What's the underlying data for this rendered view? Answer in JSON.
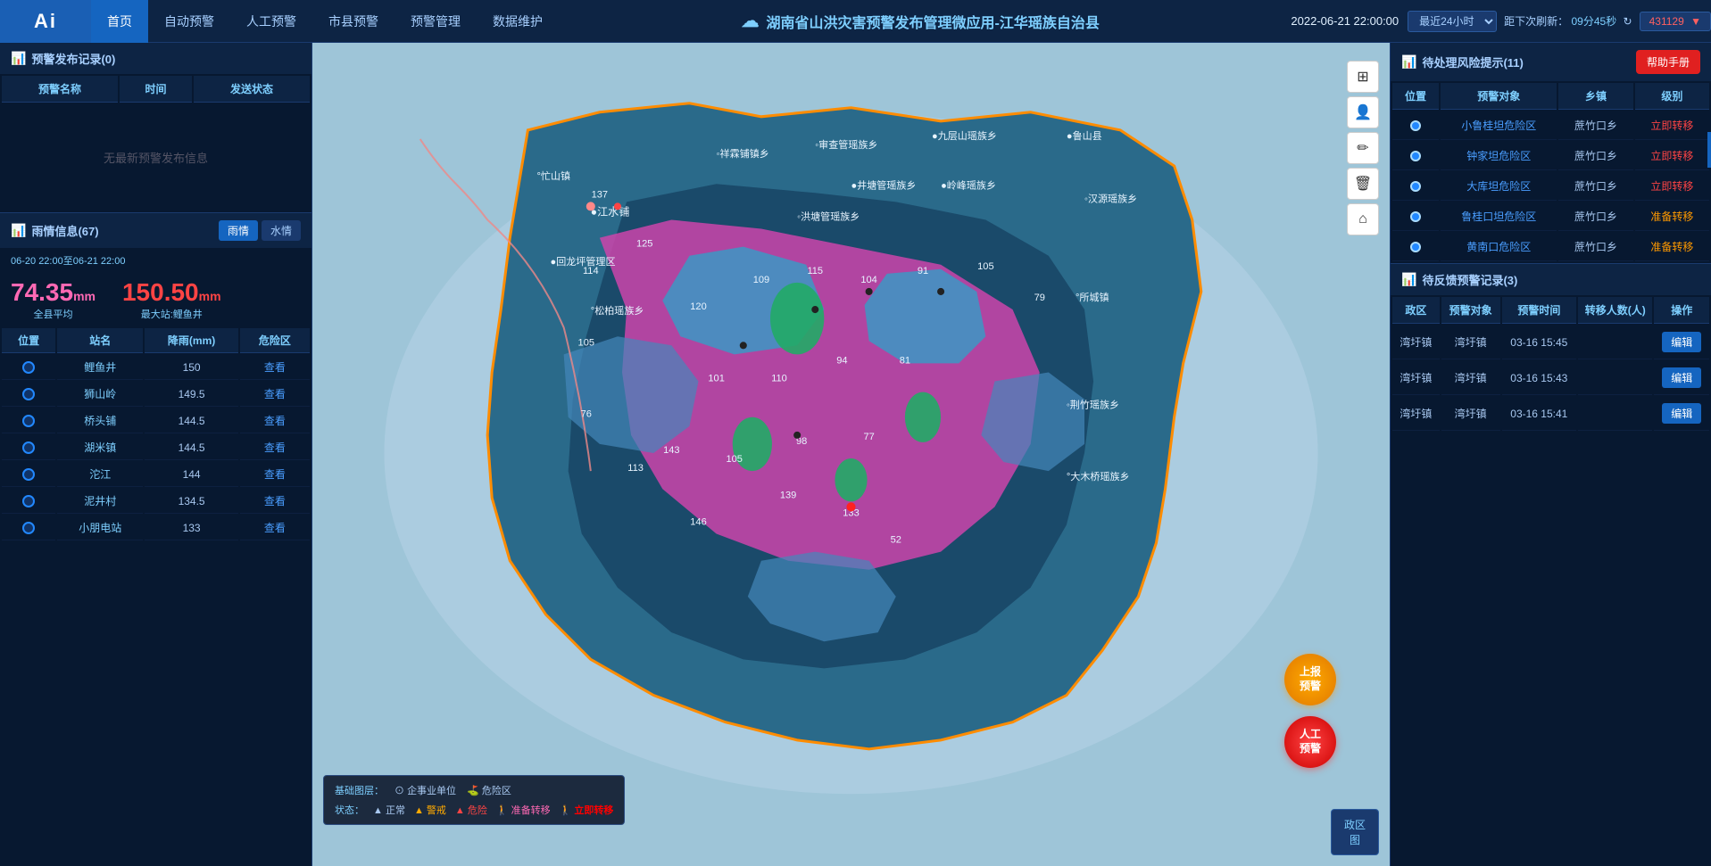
{
  "nav": {
    "logo": "Ai",
    "items": [
      "首页",
      "自动预警",
      "人工预警",
      "市县预警",
      "预警管理",
      "数据维护"
    ],
    "title": "湖南省山洪灾害预警发布管理微应用-江华瑶族自治县",
    "datetime": "2022-06-21 22:00:00",
    "time_range": "最近24小时",
    "refresh_label": "距下次刷新：",
    "refresh_time": "09分45秒",
    "count": "431129"
  },
  "warn_records": {
    "title": "预警发布记录(0)",
    "columns": [
      "预警名称",
      "时间",
      "发送状态"
    ],
    "empty_msg": "无最新预警发布信息"
  },
  "rain_info": {
    "title": "雨情信息(67)",
    "tabs": [
      "雨情",
      "水情"
    ],
    "date_range": "06-20 22:00至06-21 22:00",
    "avg_value": "74.35",
    "avg_unit": "mm",
    "avg_label": "全县平均",
    "max_value": "150.50",
    "max_unit": "mm",
    "max_label": "最大站:鲤鱼井",
    "columns": [
      "位置",
      "站名",
      "降雨(mm)",
      "危险区"
    ],
    "rows": [
      {
        "name": "鲤鱼井",
        "value": "150",
        "link": "查看"
      },
      {
        "name": "狮山岭",
        "value": "149.5",
        "link": "查看"
      },
      {
        "name": "桥头铺",
        "value": "144.5",
        "link": "查看"
      },
      {
        "name": "湖米镇",
        "value": "144.5",
        "link": "查看"
      },
      {
        "name": "沱江",
        "value": "144",
        "link": "查看"
      },
      {
        "name": "泥井村",
        "value": "134.5",
        "link": "查看"
      },
      {
        "name": "小朋电站",
        "value": "133",
        "link": "查看"
      }
    ]
  },
  "map": {
    "base_layer_label": "基础图层：",
    "enterprise_label": "企事业单位",
    "danger_zone_label": "危险区",
    "status_label": "状态：",
    "status_items": [
      "正常",
      "警戒",
      "危险",
      "准备转移",
      "立即转移"
    ],
    "float_btn_upload": [
      "上报",
      "预警"
    ],
    "float_btn_manual": [
      "人工",
      "预警"
    ],
    "policy_btn": [
      "政区",
      "图"
    ]
  },
  "risk_hints": {
    "title": "待处理风险提示(11)",
    "help_btn": "帮助手册",
    "columns": [
      "位置",
      "预警对象",
      "乡镇",
      "级别"
    ],
    "rows": [
      {
        "name": "小鲁桂坦危险区",
        "township": "蔗竹口乡",
        "action": "立即转移",
        "action_color": "red"
      },
      {
        "name": "钟家坦危险区",
        "township": "蔗竹口乡",
        "action": "立即转移",
        "action_color": "red"
      },
      {
        "name": "大库坦危险区",
        "township": "蔗竹口乡",
        "action": "立即转移",
        "action_color": "red"
      },
      {
        "name": "鲁桂口坦危险区",
        "township": "蔗竹口乡",
        "action": "准备转移",
        "action_color": "orange"
      },
      {
        "name": "黄南口危险区",
        "township": "蔗竹口乡",
        "action": "准备转移",
        "action_color": "orange"
      }
    ]
  },
  "feedback_records": {
    "title": "待反馈预警记录(3)",
    "columns": [
      "政区",
      "预警对象",
      "预警时间",
      "转移人数(人)",
      "操作"
    ],
    "rows": [
      {
        "region": "湾圩镇",
        "target": "湾圩镇",
        "time": "03-16 15:45",
        "count": "",
        "btn": "编辑"
      },
      {
        "region": "湾圩镇",
        "target": "湾圩镇",
        "time": "03-16 15:43",
        "count": "",
        "btn": "编辑"
      },
      {
        "region": "湾圩镇",
        "target": "湾圩镇",
        "time": "03-16 15:41",
        "count": "",
        "btn": "编辑"
      }
    ]
  },
  "colors": {
    "accent": "#1565c0",
    "danger_red": "#ff4444",
    "warning_orange": "#ff9900",
    "info_blue": "#4a9eff",
    "bg_dark": "#071830",
    "panel_header": "#0d2444"
  }
}
